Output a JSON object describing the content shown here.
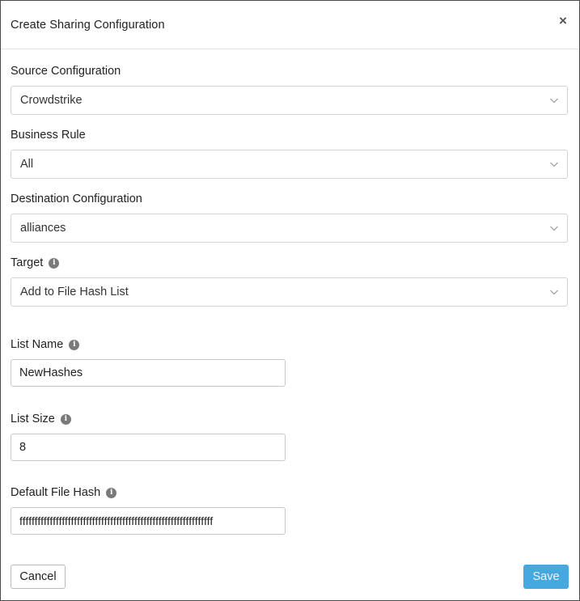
{
  "dialog": {
    "title": "Create Sharing Configuration",
    "close_glyph": "×"
  },
  "fields": {
    "source_configuration": {
      "label": "Source Configuration",
      "value": "Crowdstrike"
    },
    "business_rule": {
      "label": "Business Rule",
      "value": "All"
    },
    "destination_configuration": {
      "label": "Destination Configuration",
      "value": "alliances"
    },
    "target": {
      "label": "Target",
      "value": "Add to File Hash List",
      "info_glyph": "i"
    },
    "list_name": {
      "label": "List Name",
      "value": "NewHashes",
      "info_glyph": "i"
    },
    "list_size": {
      "label": "List Size",
      "value": "8",
      "info_glyph": "i"
    },
    "default_file_hash": {
      "label": "Default File Hash",
      "value": "ffffffffffffffffffffffffffffffffffffffffffffffffffffffffffffffff",
      "info_glyph": "i"
    }
  },
  "footer": {
    "cancel_label": "Cancel",
    "save_label": "Save"
  },
  "colors": {
    "save_button": "#45a9e0",
    "info_icon": "#7a7a7a",
    "border": "#d3d3d3"
  },
  "icons": {
    "close": "close-icon",
    "dropdown": "chevron-down-icon",
    "info": "info-icon"
  }
}
